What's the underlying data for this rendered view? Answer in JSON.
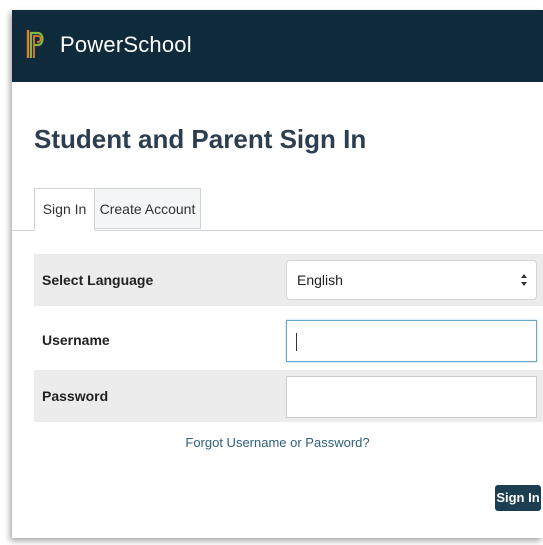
{
  "header": {
    "brand": "PowerSchool",
    "background": "#0f2a3a"
  },
  "page": {
    "title": "Student and Parent Sign In"
  },
  "tabs": [
    {
      "label": "Sign In",
      "active": true
    },
    {
      "label": "Create Account",
      "active": false
    }
  ],
  "form": {
    "language_label": "Select Language",
    "language_value": "English",
    "username_label": "Username",
    "username_value": "",
    "password_label": "Password",
    "password_value": ""
  },
  "links": {
    "forgot": "Forgot Username or Password?"
  },
  "actions": {
    "signin_label": "Sign In"
  },
  "icons": {
    "logo": "powerschool-logo-icon",
    "select_arrows": "select-updown-icon"
  },
  "colors": {
    "accent": "#1b3e52",
    "link": "#2f5f7a",
    "logo_green": "#7db940",
    "logo_orange": "#e47b2a"
  }
}
